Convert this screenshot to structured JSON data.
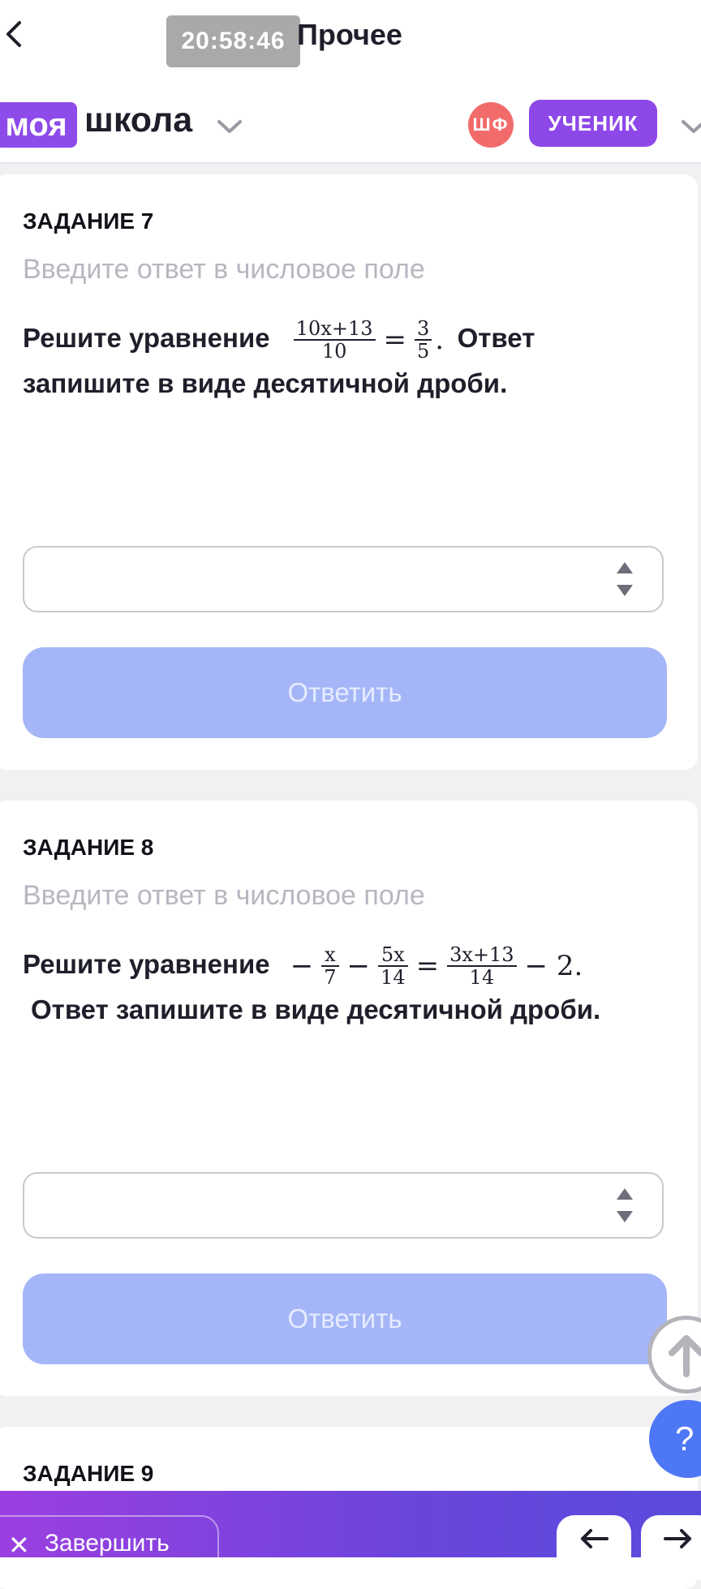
{
  "topbar": {
    "timer": "20:58:46",
    "title": "Прочее"
  },
  "header": {
    "logo_part1": "моя",
    "logo_part2": "школа",
    "avatar_initials": "ШФ",
    "role": "УЧЕНИК"
  },
  "tasks": [
    {
      "label": "ЗАДАНИЕ 7",
      "hint": "Введите ответ в числовое поле",
      "q_prefix": "Решите уравнение",
      "q_suffix": "Ответ",
      "q_line2": "запишите в виде десятичной дроби.",
      "math": {
        "f1_num": "10x+13",
        "f1_den": "10",
        "eq": "=",
        "f2_num": "3",
        "f2_den": "5",
        "dot": "."
      },
      "submit_label": "Ответить"
    },
    {
      "label": "ЗАДАНИЕ 8",
      "hint": "Введите ответ в числовое поле",
      "q_prefix": "Решите уравнение",
      "q_line2": "Ответ запишите в виде десятичной дроби.",
      "math": {
        "minus1": "−",
        "f1_num": "x",
        "f1_den": "7",
        "minus2": "−",
        "f2_num": "5x",
        "f2_den": "14",
        "eq": "=",
        "f3_num": "3x+13",
        "f3_den": "14",
        "tail": "− 2."
      },
      "submit_label": "Ответить"
    },
    {
      "label": "ЗАДАНИЕ 9"
    }
  ],
  "floating": {
    "help_label": "?"
  },
  "bottombar": {
    "finish_label": "Завершить"
  },
  "colors": {
    "brand_purple": "#8d4bea",
    "submit_disabled": "#a5b6f8",
    "help_blue": "#4d77f5",
    "avatar_red": "#f26b6b"
  },
  "icons": [
    "back-arrow-icon",
    "chevron-down-icon",
    "stepper-icon",
    "arrow-up-icon",
    "close-icon",
    "arrow-left-icon",
    "arrow-right-icon"
  ]
}
